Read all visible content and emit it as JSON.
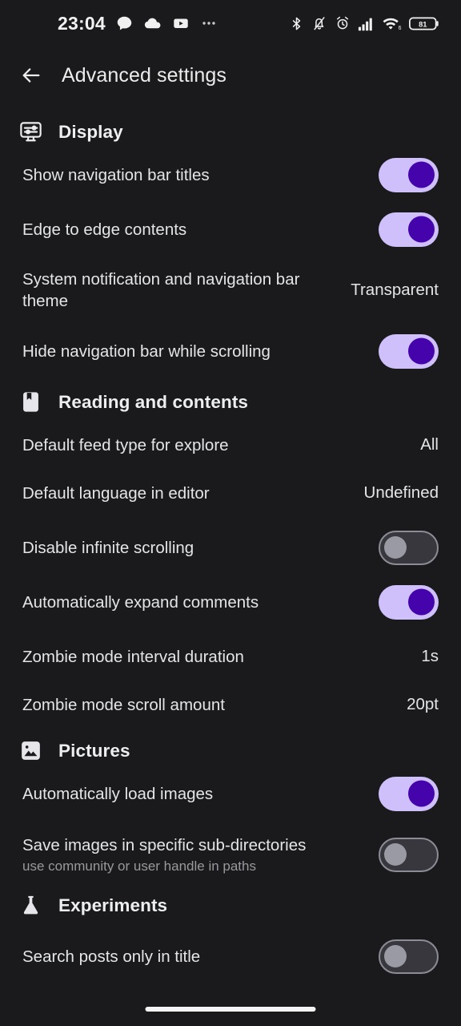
{
  "status_bar": {
    "time": "23:04",
    "left_icons": [
      "chat-bubble-icon",
      "cloud-icon",
      "youtube-icon",
      "more-notifications-icon"
    ],
    "right_icons": [
      "bluetooth-icon",
      "notifications-silenced-icon",
      "alarm-clock-icon",
      "cellular-signal-icon",
      "wifi-icon",
      "battery-icon"
    ],
    "wifi_generation": "6",
    "battery_level": "81"
  },
  "app_bar": {
    "back_icon": "arrow-left-icon",
    "title": "Advanced settings"
  },
  "theme": {
    "background": "#1a1a1c",
    "toggle_on_track": "#cfc0fb",
    "toggle_on_knob": "#4504ab",
    "toggle_off_track": "#37373d",
    "toggle_off_knob": "#9a9aa4",
    "primary_text": "#e4e5e7",
    "secondary_text": "#98989d"
  },
  "sections": [
    {
      "id": "display",
      "title": "Display",
      "icon": "display-settings-icon",
      "rows": [
        {
          "label": "Show navigation bar titles",
          "type": "toggle",
          "state": "on"
        },
        {
          "label": "Edge to edge contents",
          "type": "toggle",
          "state": "on"
        },
        {
          "label": "System notification and navigation bar theme",
          "type": "value",
          "value": "Transparent"
        },
        {
          "label": "Hide navigation bar while scrolling",
          "type": "toggle",
          "state": "on"
        }
      ]
    },
    {
      "id": "reading-and-contents",
      "title": "Reading and contents",
      "icon": "bookmark-book-icon",
      "rows": [
        {
          "label": "Default feed type for explore",
          "type": "value",
          "value": "All"
        },
        {
          "label": "Default language in editor",
          "type": "value",
          "value": "Undefined"
        },
        {
          "label": "Disable infinite scrolling",
          "type": "toggle",
          "state": "off"
        },
        {
          "label": "Automatically expand comments",
          "type": "toggle",
          "state": "on"
        },
        {
          "label": "Zombie mode interval duration",
          "type": "value",
          "value": "1s"
        },
        {
          "label": "Zombie mode scroll amount",
          "type": "value",
          "value": "20pt"
        }
      ]
    },
    {
      "id": "pictures",
      "title": "Pictures",
      "icon": "image-icon",
      "rows": [
        {
          "label": "Automatically load images",
          "type": "toggle",
          "state": "on"
        },
        {
          "label": "Save images in specific sub-directories",
          "sublabel": "use community or user handle in paths",
          "type": "toggle",
          "state": "off"
        }
      ]
    },
    {
      "id": "experiments",
      "title": "Experiments",
      "icon": "flask-icon",
      "rows": [
        {
          "label": "Search posts only in title",
          "type": "toggle",
          "state": "off"
        }
      ]
    }
  ]
}
